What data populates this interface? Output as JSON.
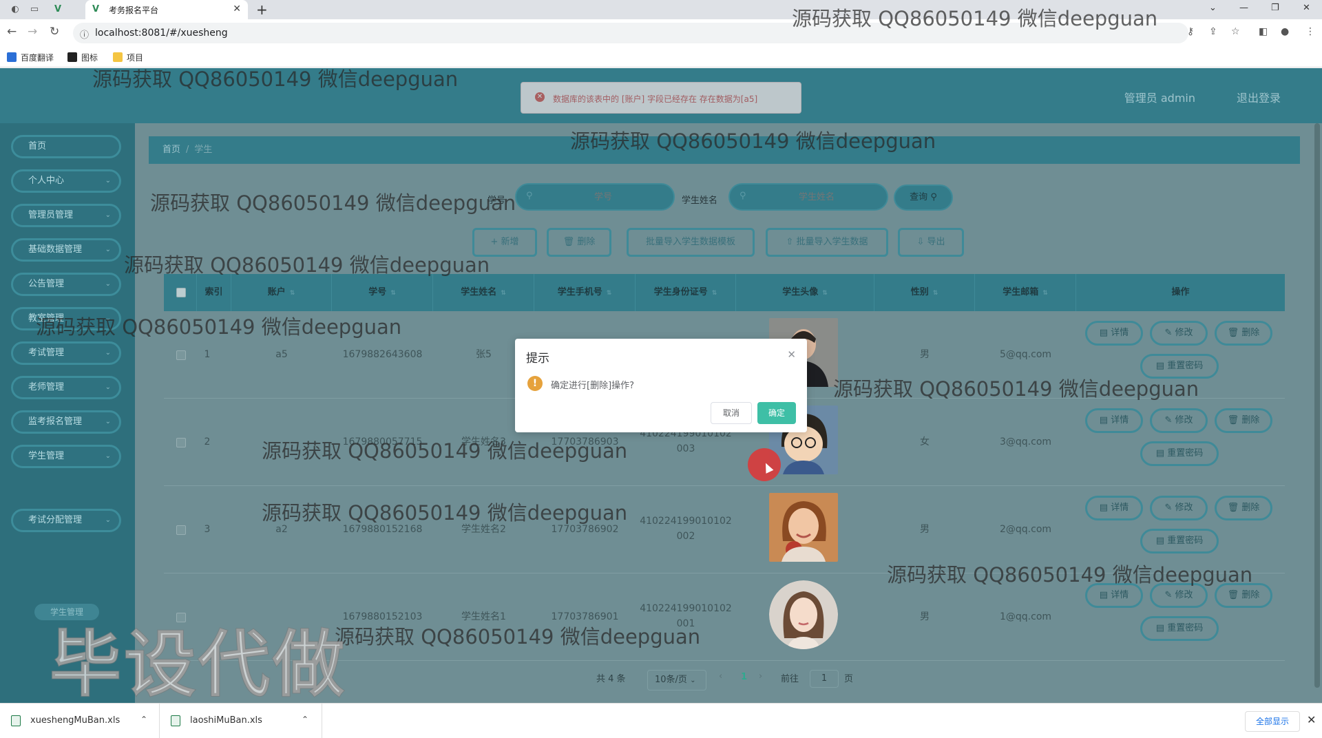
{
  "browser": {
    "tab_title": "考务报名平台",
    "url": "localhost:8081/#/xuesheng",
    "bookmarks": [
      "百度翻译",
      "图标",
      "项目"
    ]
  },
  "header": {
    "user_label": "管理员 admin",
    "logout_label": "退出登录"
  },
  "toast": {
    "message": "数据库的该表中的 [账户] 字段已经存在 存在数据为[a5]"
  },
  "sidebar": {
    "items": [
      {
        "label": "首页",
        "has_submenu": false
      },
      {
        "label": "个人中心",
        "has_submenu": true
      },
      {
        "label": "管理员管理",
        "has_submenu": true
      },
      {
        "label": "基础数据管理",
        "has_submenu": true
      },
      {
        "label": "公告管理",
        "has_submenu": true
      },
      {
        "label": "教室管理",
        "has_submenu": true
      },
      {
        "label": "考试管理",
        "has_submenu": true
      },
      {
        "label": "老师管理",
        "has_submenu": true
      },
      {
        "label": "监考报名管理",
        "has_submenu": true
      },
      {
        "label": "学生管理",
        "has_submenu": true
      },
      {
        "label": "考试分配管理",
        "has_submenu": true
      }
    ],
    "active_sub": "学生管理"
  },
  "breadcrumb": {
    "home": "首页",
    "current": "学生"
  },
  "search": {
    "field1_label": "学号",
    "field1_placeholder": "学号",
    "field2_label": "学生姓名",
    "field2_placeholder": "学生姓名",
    "query_label": "查询"
  },
  "actions": {
    "add": "新增",
    "delete": "删除",
    "template": "批量导入学生数据模板",
    "import": "批量导入学生数据",
    "export": "导出"
  },
  "table": {
    "columns": [
      "索引",
      "账户",
      "学号",
      "学生姓名",
      "学生手机号",
      "学生身份证号",
      "学生头像",
      "性别",
      "学生邮箱",
      "操作"
    ],
    "rows": [
      {
        "index": "1",
        "account": "a5",
        "student_no": "1679882643608",
        "name": "张5",
        "phone": "",
        "id_card_1": "",
        "id_card_2": "",
        "gender": "男",
        "email": "5@qq.com"
      },
      {
        "index": "2",
        "account": "",
        "student_no": "1679880057715",
        "name": "学生姓名3",
        "phone": "17703786903",
        "id_card_1": "410224199010102",
        "id_card_2": "003",
        "gender": "女",
        "email": "3@qq.com"
      },
      {
        "index": "3",
        "account": "a2",
        "student_no": "1679880152168",
        "name": "学生姓名2",
        "phone": "17703786902",
        "id_card_1": "410224199010102",
        "id_card_2": "002",
        "gender": "男",
        "email": "2@qq.com"
      },
      {
        "index": "",
        "account": "",
        "student_no": "1679880152103",
        "name": "学生姓名1",
        "phone": "17703786901",
        "id_card_1": "410224199010102",
        "id_card_2": "001",
        "gender": "男",
        "email": "1@qq.com"
      }
    ],
    "row_actions": {
      "detail": "详情",
      "edit": "修改",
      "delete": "删除",
      "reset": "重置密码"
    }
  },
  "pagination": {
    "total": "共 4 条",
    "page_size": "10条/页",
    "current_page": "1",
    "goto_label": "前往",
    "goto_value": "1",
    "page_suffix": "页"
  },
  "dialog": {
    "title": "提示",
    "message": "确定进行[删除]操作?",
    "cancel": "取消",
    "confirm": "确定"
  },
  "downloads": {
    "file1": "xueshengMuBan.xls",
    "file2": "laoshiMuBan.xls",
    "show_all": "全部显示"
  },
  "watermark": {
    "text": "源码获取 QQ86050149 微信deepguan",
    "big": "毕设代做"
  },
  "colors": {
    "header": "#347c8a",
    "sidebar": "#2e6f7c",
    "overlay": "#6f8e94",
    "confirm": "#3ebfa6",
    "warning": "#e6a23c",
    "error": "#d9534f"
  },
  "icons": [
    "back-icon",
    "forward-icon",
    "reload-icon",
    "info-icon",
    "key-icon",
    "share-icon",
    "star-icon",
    "sidepanel-icon",
    "profile-icon",
    "menu-icon",
    "search-icon",
    "plus-icon",
    "trash-icon",
    "upload-icon",
    "download-icon",
    "doc-icon",
    "edit-icon",
    "warning-icon",
    "close-icon",
    "error-icon"
  ]
}
